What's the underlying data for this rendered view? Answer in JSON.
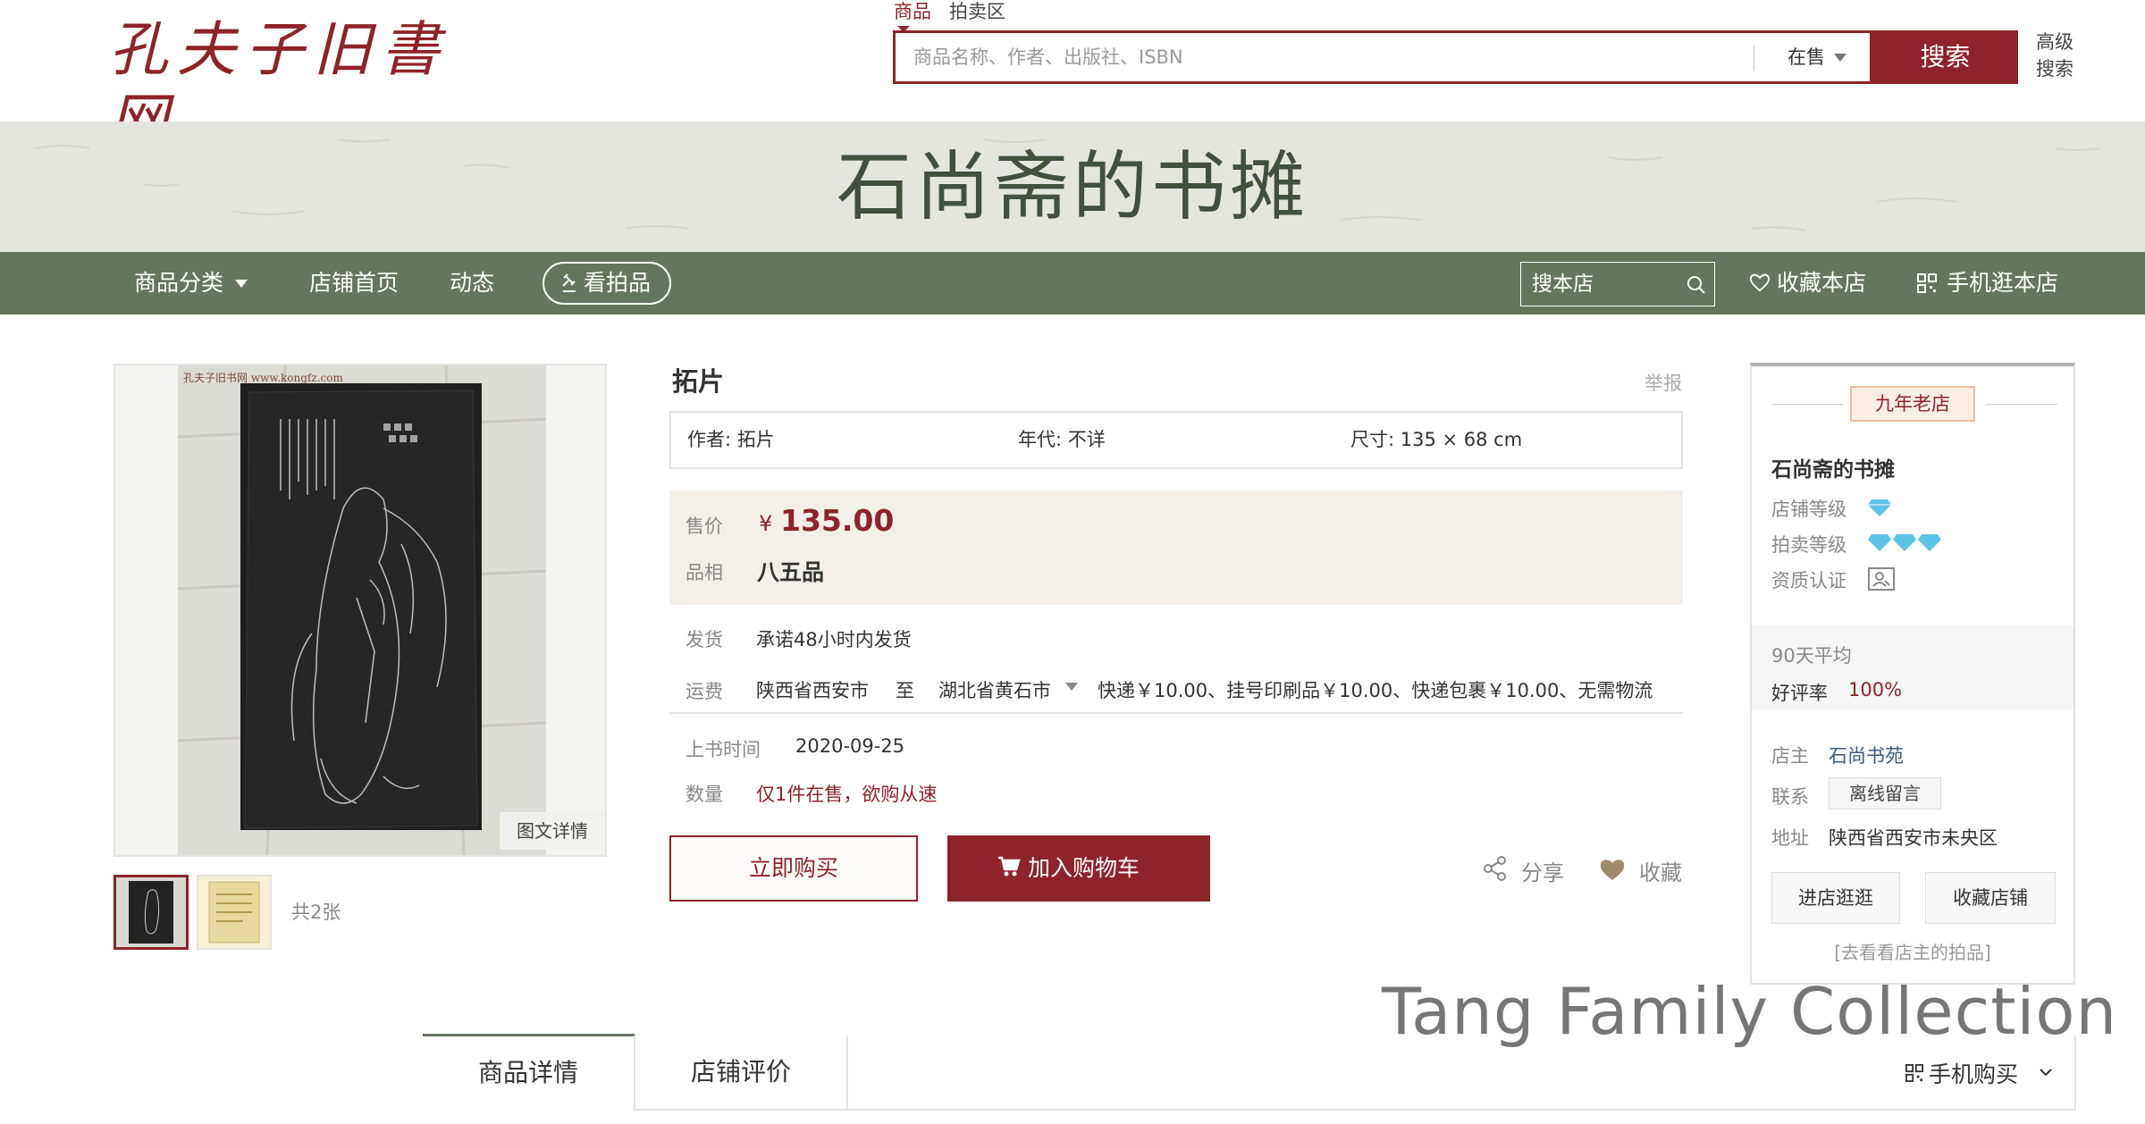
{
  "site": {
    "logo_text": "孔夫子旧書网"
  },
  "search": {
    "tabs": [
      "商品",
      "拍卖区"
    ],
    "placeholder": "商品名称、作者、出版社、ISBN",
    "scope": "在售",
    "button": "搜索",
    "advanced": "高级搜索"
  },
  "shop_banner": {
    "title": "石尚斋的书摊"
  },
  "nav": {
    "category": "商品分类",
    "home": "店铺首页",
    "dynamics": "动态",
    "auction": "看拍品",
    "shop_search_placeholder": "搜本店",
    "favorite_shop": "收藏本店",
    "mobile_shop": "手机逛本店"
  },
  "gallery": {
    "detail_label": "图文详情",
    "count_text": "共2张",
    "watermark_text": "孔夫子旧书网 www.kongfz.com"
  },
  "product": {
    "title": "拓片",
    "report": "举报",
    "attrs": [
      "作者: 拓片",
      "年代: 不详",
      "尺寸: 135 × 68 cm"
    ],
    "price_label": "售价",
    "price_symbol": "¥",
    "price": "135.00",
    "condition_label": "品相",
    "condition": "八五品",
    "shipping_label": "发货",
    "shipping": "承诺48小时内发货",
    "fee_label": "运费",
    "fee_from": "陕西省西安市",
    "fee_to": "至",
    "fee_dest": "湖北省黄石市",
    "fee_detail": "快递￥10.00、挂号印刷品￥10.00、快递包裹￥10.00、无需物流",
    "date_label": "上书时间",
    "date": "2020-09-25",
    "qty_label": "数量",
    "qty": "仅1件在售，欲购从速",
    "buy_now": "立即购买",
    "add_cart": "加入购物车",
    "share": "分享",
    "collect": "收藏"
  },
  "shop_card": {
    "badge": "九年老店",
    "name": "石尚斋的书摊",
    "level_label": "店铺等级",
    "auction_level_label": "拍卖等级",
    "cert_label": "资质认证",
    "avg_label": "90天平均",
    "rate_label": "好评率",
    "rate": "100%",
    "owner_label": "店主",
    "owner": "石尚书苑",
    "contact_label": "联系",
    "contact_btn": "离线留言",
    "addr_label": "地址",
    "addr": "陕西省西安市未央区",
    "enter_btn": "进店逛逛",
    "fav_btn": "收藏店铺",
    "see_auctions": "[去看看店主的拍品]"
  },
  "tabs": {
    "detail": "商品详情",
    "reviews": "店铺评价",
    "mobile_buy": "手机购买"
  },
  "watermark": "Tang Family Collection",
  "colors": {
    "brand": "#8e2329",
    "nav": "#66755f",
    "price_bg": "#f3f0e9"
  }
}
